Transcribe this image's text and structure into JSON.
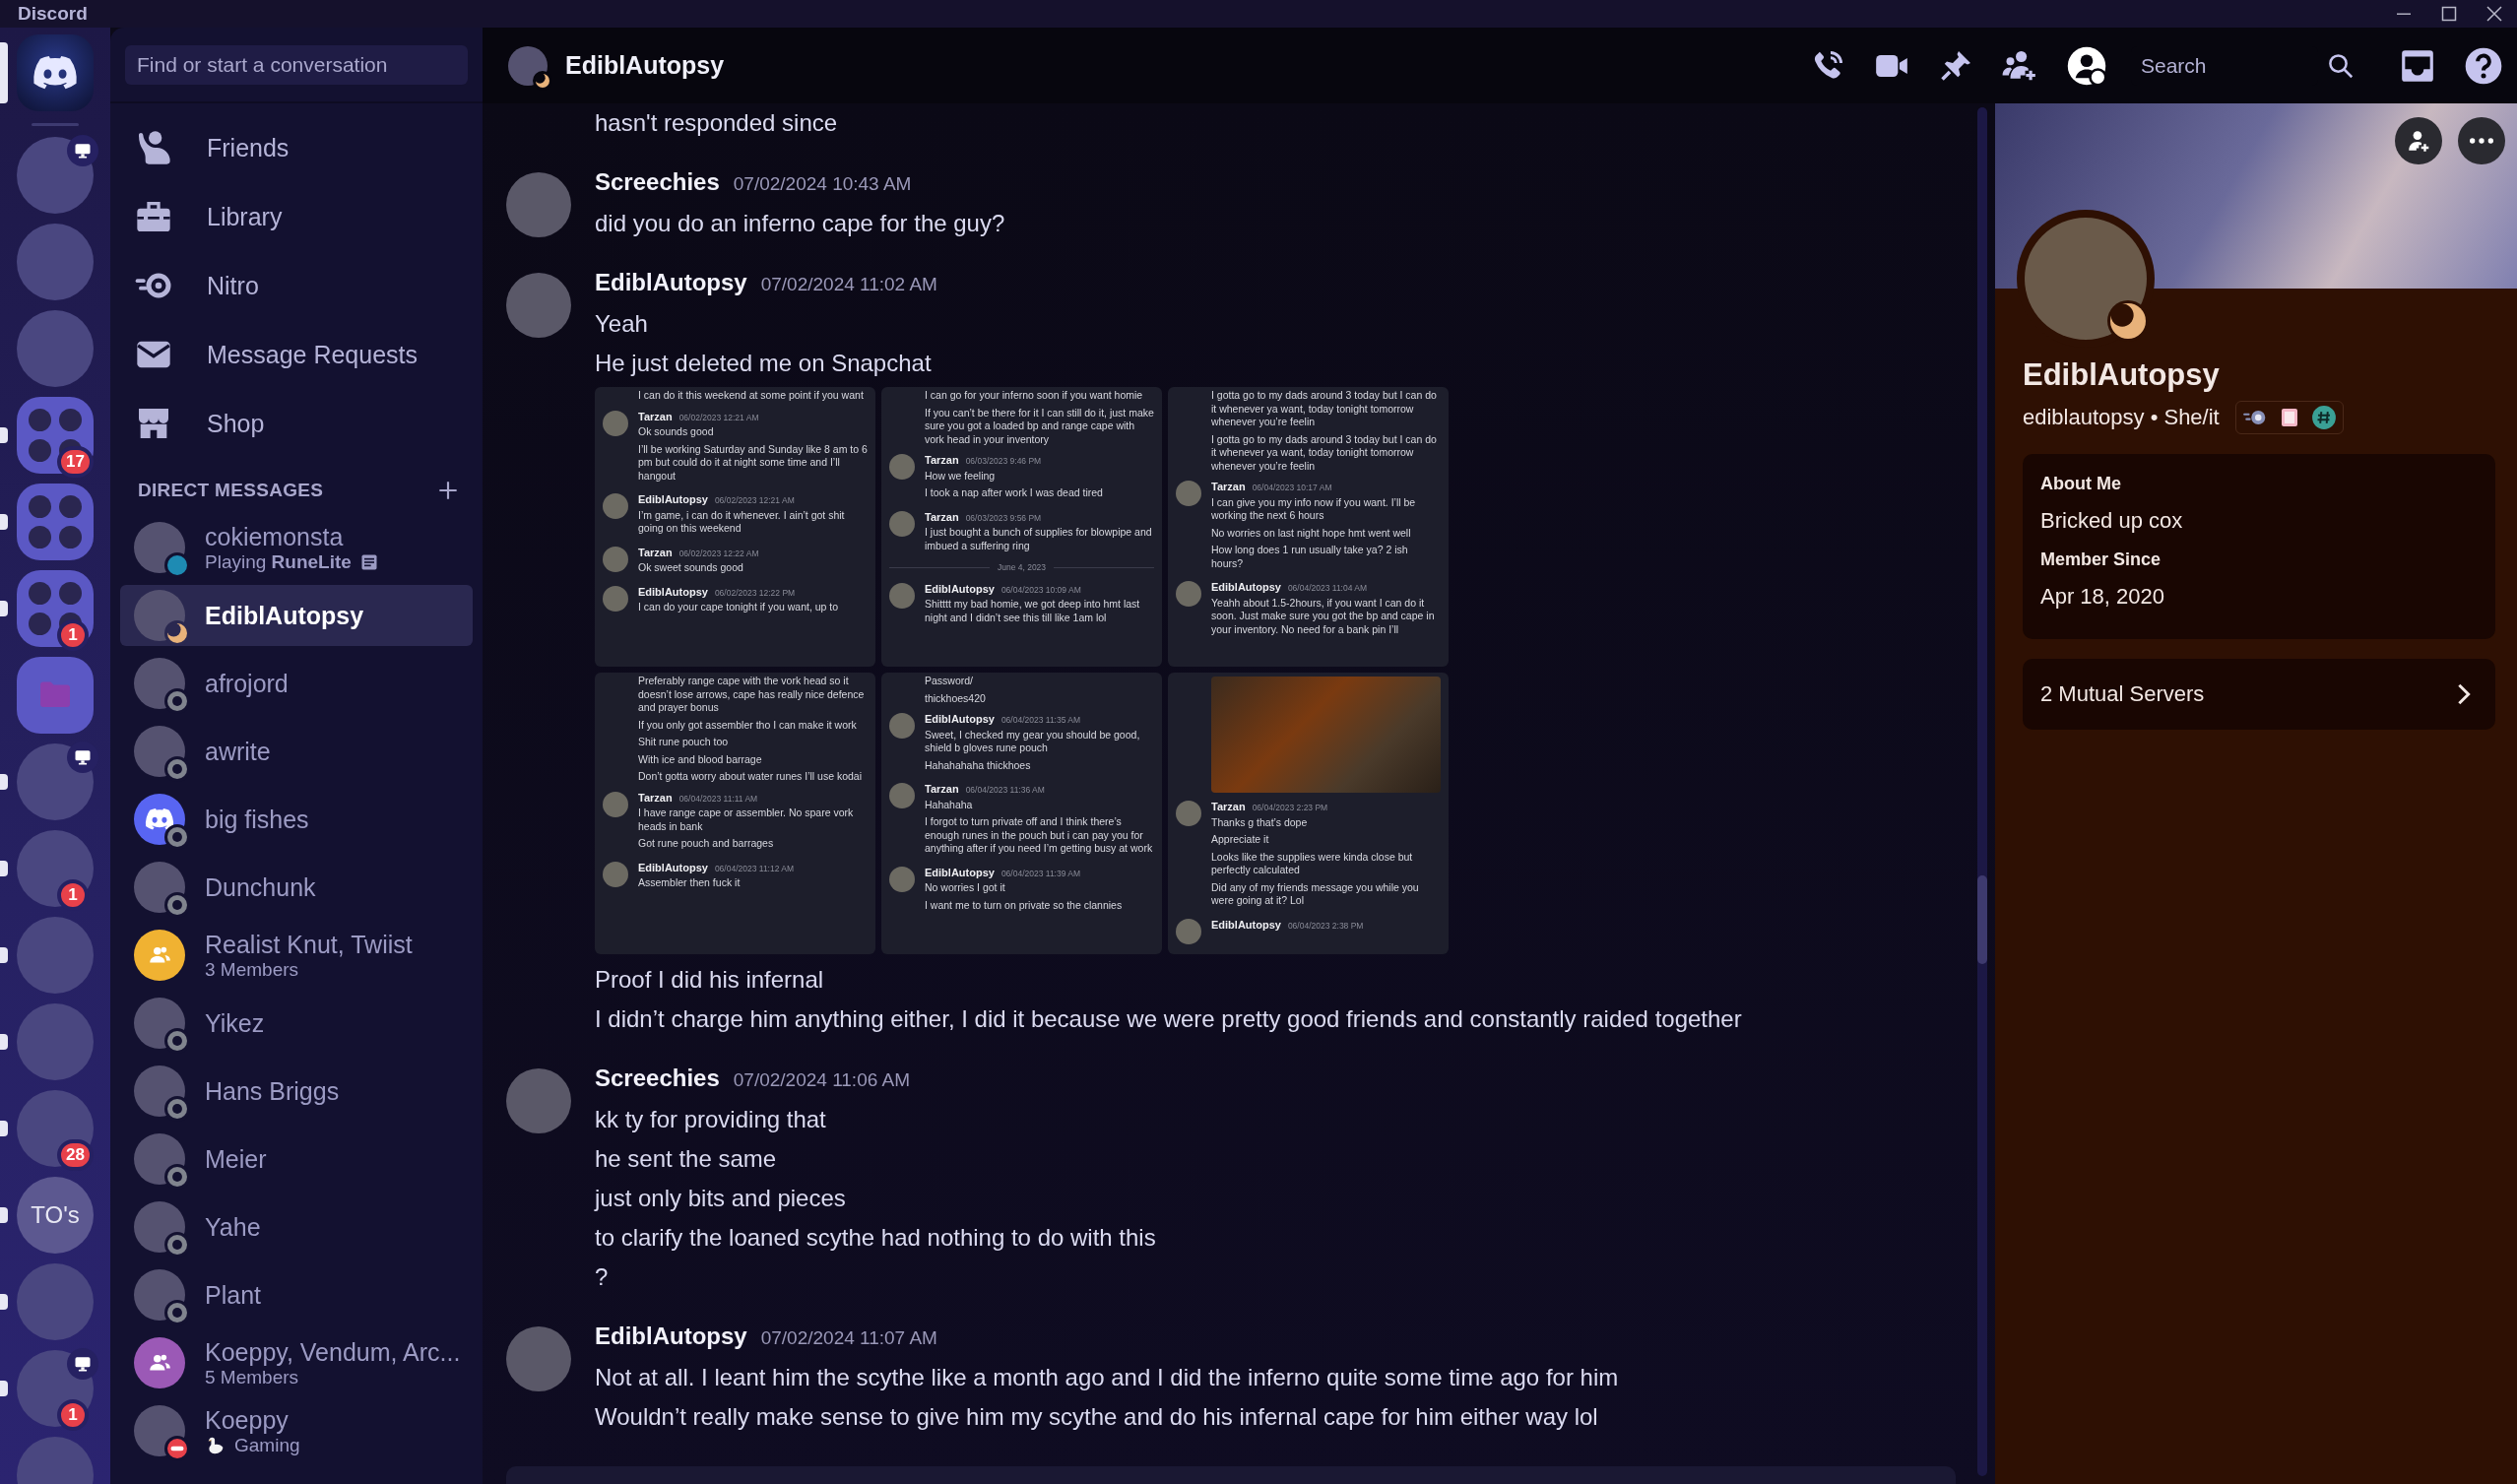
{
  "app": {
    "title": "Discord"
  },
  "servers": [
    {
      "kind": "home",
      "selected": true,
      "unread": false,
      "streaming": false
    },
    {
      "kind": "image",
      "selected": false,
      "unread": false,
      "streaming": true
    },
    {
      "kind": "image",
      "selected": false,
      "unread": false,
      "streaming": false
    },
    {
      "kind": "image",
      "selected": false,
      "unread": false,
      "streaming": false
    },
    {
      "kind": "folder",
      "selected": false,
      "unread": true,
      "streaming": false,
      "badge": "17"
    },
    {
      "kind": "folder",
      "selected": false,
      "unread": true,
      "streaming": false
    },
    {
      "kind": "folder",
      "selected": false,
      "unread": true,
      "streaming": false,
      "badge": "1"
    },
    {
      "kind": "folder-closed",
      "selected": false,
      "unread": false,
      "streaming": false
    },
    {
      "kind": "image",
      "selected": false,
      "unread": true,
      "streaming": true
    },
    {
      "kind": "image",
      "selected": false,
      "unread": true,
      "streaming": false,
      "badge": "1"
    },
    {
      "kind": "image",
      "selected": false,
      "unread": true,
      "streaming": false
    },
    {
      "kind": "image",
      "selected": false,
      "unread": true,
      "streaming": false
    },
    {
      "kind": "image",
      "selected": false,
      "unread": true,
      "streaming": false,
      "badge": "28"
    },
    {
      "kind": "text",
      "selected": false,
      "unread": true,
      "streaming": false,
      "text": "TO's"
    },
    {
      "kind": "image",
      "selected": false,
      "unread": true,
      "streaming": false
    },
    {
      "kind": "image",
      "selected": false,
      "unread": true,
      "streaming": true,
      "badge": "1"
    },
    {
      "kind": "image",
      "selected": false,
      "unread": false,
      "streaming": false
    }
  ],
  "sidebar": {
    "search_placeholder": "Find or start a conversation",
    "nav": [
      {
        "kind": "friends",
        "label": "Friends"
      },
      {
        "kind": "library",
        "label": "Library"
      },
      {
        "kind": "nitro",
        "label": "Nitro"
      },
      {
        "kind": "requests",
        "label": "Message Requests"
      },
      {
        "kind": "shop",
        "label": "Shop"
      }
    ],
    "dm_heading": "DIRECT MESSAGES",
    "dms": [
      {
        "name": "cokiemonsta",
        "subtitle": "Playing **RuneLite**",
        "activity": {
          "kind": "document"
        },
        "kind": "photo",
        "presence": {
          "kind": "online"
        },
        "selected": false
      },
      {
        "name": "EdiblAutopsy",
        "kind": "photo",
        "presence": {
          "kind": "idle"
        },
        "selected": true
      },
      {
        "name": "afrojord",
        "kind": "photo",
        "presence": {
          "kind": "offline"
        },
        "selected": false
      },
      {
        "name": "awrite",
        "kind": "photo",
        "presence": {
          "kind": "offline"
        },
        "selected": false
      },
      {
        "name": "big fishes",
        "kind": "default",
        "color": "#5865f2",
        "presence": {
          "kind": "offline"
        },
        "selected": false
      },
      {
        "name": "Dunchunk",
        "kind": "photo",
        "presence": {
          "kind": "offline"
        },
        "selected": false
      },
      {
        "name": "Realist Knut, Twiist",
        "subtitle": "3 Members",
        "kind": "group",
        "color": "#f0b232",
        "selected": false
      },
      {
        "name": "Yikez",
        "kind": "photo",
        "presence": {
          "kind": "offline"
        },
        "selected": false
      },
      {
        "name": "Hans Briggs",
        "kind": "photo",
        "presence": {
          "kind": "offline"
        },
        "selected": false
      },
      {
        "name": "Meier",
        "kind": "photo",
        "presence": {
          "kind": "offline"
        },
        "selected": false
      },
      {
        "name": "Yahe",
        "kind": "photo",
        "presence": {
          "kind": "offline"
        },
        "selected": false
      },
      {
        "name": "Plant",
        "kind": "photo",
        "presence": {
          "kind": "offline"
        },
        "selected": false
      },
      {
        "name": "Koeppy, Vendum, Arc...",
        "subtitle": "5 Members",
        "kind": "group",
        "color": "#9b59b6",
        "selected": false
      },
      {
        "name": "Koeppy",
        "subtitle": "Gaming",
        "activity": {
          "kind": "bird"
        },
        "kind": "photo",
        "presence": {
          "kind": "dnd"
        },
        "selected": false
      }
    ]
  },
  "header": {
    "name": "EdiblAutopsy",
    "presence": {
      "kind": "idle"
    },
    "search_placeholder": "Search"
  },
  "messages": [
    {
      "items": [
        {
          "kind": "text",
          "text": "hasn't responded since"
        }
      ]
    },
    {
      "author": "Screechies",
      "time": "07/02/2024 10:43 AM",
      "items": [
        {
          "kind": "text",
          "text": "did you do an inferno cape for the guy?"
        }
      ]
    },
    {
      "author": "EdiblAutopsy",
      "time": "07/02/2024 11:02 AM",
      "items": [
        {
          "kind": "text",
          "text": "Yeah"
        },
        {
          "kind": "text",
          "text": "He just deleted me on Snapchat"
        },
        {
          "kind": "gallery",
          "panels": [
            {
              "items": [
                {
                  "kind": "text",
                  "text": "I can do it this weekend at some point if you want"
                },
                {
                  "kind": "message",
                  "author": "Tarzan",
                  "time": "06/02/2023 12:21 AM",
                  "lines": [
                    "Ok sounds good",
                    "I’ll be working Saturday and Sunday like 8 am to 6 pm but could do it at night some time and I’ll hangout"
                  ]
                },
                {
                  "kind": "message",
                  "author": "EdiblAutopsy",
                  "time": "06/02/2023 12:21 AM",
                  "lines": [
                    "I’m game, i can do it whenever. I ain’t got shit going on this weekend"
                  ]
                },
                {
                  "kind": "message",
                  "author": "Tarzan",
                  "time": "06/02/2023 12:22 AM",
                  "lines": [
                    "Ok sweet sounds good"
                  ]
                },
                {
                  "kind": "message",
                  "author": "EdiblAutopsy",
                  "time": "06/02/2023 12:22 PM",
                  "lines": [
                    "I can do your cape tonight if you want, up to"
                  ]
                }
              ]
            },
            {
              "items": [
                {
                  "kind": "text",
                  "text": "I can go for your inferno soon if you want homie"
                },
                {
                  "kind": "text",
                  "text": "If you can’t be there for it I can still do it, just make sure you got a loaded bp and range cape with vork head in your inventory"
                },
                {
                  "kind": "message",
                  "author": "Tarzan",
                  "time": "06/03/2023 9:46 PM",
                  "lines": [
                    "How we feeling",
                    "I took a nap after work I was dead tired"
                  ]
                },
                {
                  "kind": "message",
                  "author": "Tarzan",
                  "time": "06/03/2023 9:56 PM",
                  "lines": [
                    "I just bought a bunch of supplies for blowpipe and imbued a suffering ring"
                  ]
                },
                {
                  "kind": "divider",
                  "text": "June 4, 2023"
                },
                {
                  "kind": "message",
                  "author": "EdiblAutopsy",
                  "time": "06/04/2023 10:09 AM",
                  "lines": [
                    "Shitttt my bad homie, we got deep into hmt last night and I didn’t see this till like 1am lol"
                  ]
                }
              ]
            },
            {
              "items": [
                {
                  "kind": "text",
                  "text": "I gotta go to my dads around 3 today but I can do it whenever ya want, today tonight tomorrow whenever you’re feelin"
                },
                {
                  "kind": "text",
                  "text": "I gotta go to my dads around 3 today but I can do it whenever ya want, today tonight tomorrow whenever you’re feelin"
                },
                {
                  "kind": "message",
                  "author": "Tarzan",
                  "time": "06/04/2023 10:17 AM",
                  "lines": [
                    "I can give you my info now if you want. I’ll be working the next 6 hours",
                    "No worries on last night hope hmt went well",
                    "How long does 1 run usually take ya? 2 ish hours?"
                  ]
                },
                {
                  "kind": "message",
                  "author": "EdiblAutopsy",
                  "time": "06/04/2023 11:04 AM",
                  "lines": [
                    "Yeahh about 1.5-2hours, if you want I can do it soon. Just make sure you got the bp and cape in your inventory. No need for a bank pin I’ll"
                  ]
                }
              ]
            },
            {
              "items": [
                {
                  "kind": "text",
                  "text": "Preferably range cape with the vork head so it doesn’t lose arrows, cape has really nice defence and prayer bonus"
                },
                {
                  "kind": "text",
                  "text": "If you only got assembler tho I can make it work"
                },
                {
                  "kind": "text",
                  "text": "Shit rune pouch too"
                },
                {
                  "kind": "text",
                  "text": "With ice and blood barrage"
                },
                {
                  "kind": "text",
                  "text": "Don’t gotta worry about water runes I’ll use kodai"
                },
                {
                  "kind": "message",
                  "author": "Tarzan",
                  "time": "06/04/2023 11:11 AM",
                  "lines": [
                    "I have range cape or assembler. No spare vork heads in bank",
                    "Got rune pouch and barrages"
                  ]
                },
                {
                  "kind": "message",
                  "author": "EdiblAutopsy",
                  "time": "06/04/2023 11:12 AM",
                  "lines": [
                    "Assembler then fuck it"
                  ]
                }
              ]
            },
            {
              "items": [
                {
                  "kind": "text",
                  "text": "Password/"
                },
                {
                  "kind": "text",
                  "text": "thickhoes420"
                },
                {
                  "kind": "message",
                  "author": "EdiblAutopsy",
                  "time": "06/04/2023 11:35 AM",
                  "lines": [
                    "Sweet, I checked my gear you should be good, shield b gloves rune pouch",
                    "Hahahahaha thickhoes"
                  ]
                },
                {
                  "kind": "message",
                  "author": "Tarzan",
                  "time": "06/04/2023 11:36 AM",
                  "lines": [
                    "Hahahaha",
                    "I forgot to turn private off and I think there’s enough runes in the pouch but i can pay you for anything after if you need I’m getting busy at work"
                  ]
                },
                {
                  "kind": "message",
                  "author": "EdiblAutopsy",
                  "time": "06/04/2023 11:39 AM",
                  "lines": [
                    "No worries I got it",
                    "I want me to turn on private so the clannies"
                  ]
                }
              ]
            },
            {
              "items": [
                {
                  "kind": "image"
                },
                {
                  "kind": "message",
                  "author": "Tarzan",
                  "time": "06/04/2023 2:23 PM",
                  "lines": [
                    "Thanks g that’s dope",
                    "Appreciate it",
                    "Looks like the supplies were kinda close but perfectly calculated",
                    "Did any of my friends message you while you were going at it? Lol"
                  ]
                },
                {
                  "kind": "message",
                  "author": "EdiblAutopsy",
                  "time": "06/04/2023 2:38 PM"
                }
              ]
            }
          ]
        },
        {
          "kind": "text",
          "text": "Proof I did his infernal"
        },
        {
          "kind": "text",
          "text": "I didn’t charge him anything either, I did it because we were pretty good friends and constantly raided together"
        }
      ]
    },
    {
      "author": "Screechies",
      "time": "07/02/2024 11:06 AM",
      "items": [
        {
          "kind": "text",
          "text": "kk ty for providing that"
        },
        {
          "kind": "text",
          "text": "he sent the same"
        },
        {
          "kind": "text",
          "text": "just only bits and pieces"
        },
        {
          "kind": "text",
          "text": "to clarify the loaned scythe had nothing to do with this"
        },
        {
          "kind": "text",
          "text": "?"
        }
      ]
    },
    {
      "author": "EdiblAutopsy",
      "time": "07/02/2024 11:07 AM",
      "items": [
        {
          "kind": "text",
          "text": "Not at all. I leant him the scythe like a month ago and I did the inferno quite some time ago for him"
        },
        {
          "kind": "text",
          "text": "Wouldn’t really make sense to give him my scythe and do his infernal cape for him either way lol"
        }
      ]
    }
  ],
  "profile": {
    "display_name": "EdiblAutopsy",
    "presence": {
      "kind": "idle"
    },
    "username_line": "ediblautopsy • She/it",
    "about_title": "About Me",
    "about": "Bricked up cox",
    "member_since_title": "Member Since",
    "member_since": "Apr 18, 2020",
    "mutual": "2 Mutual Servers"
  }
}
